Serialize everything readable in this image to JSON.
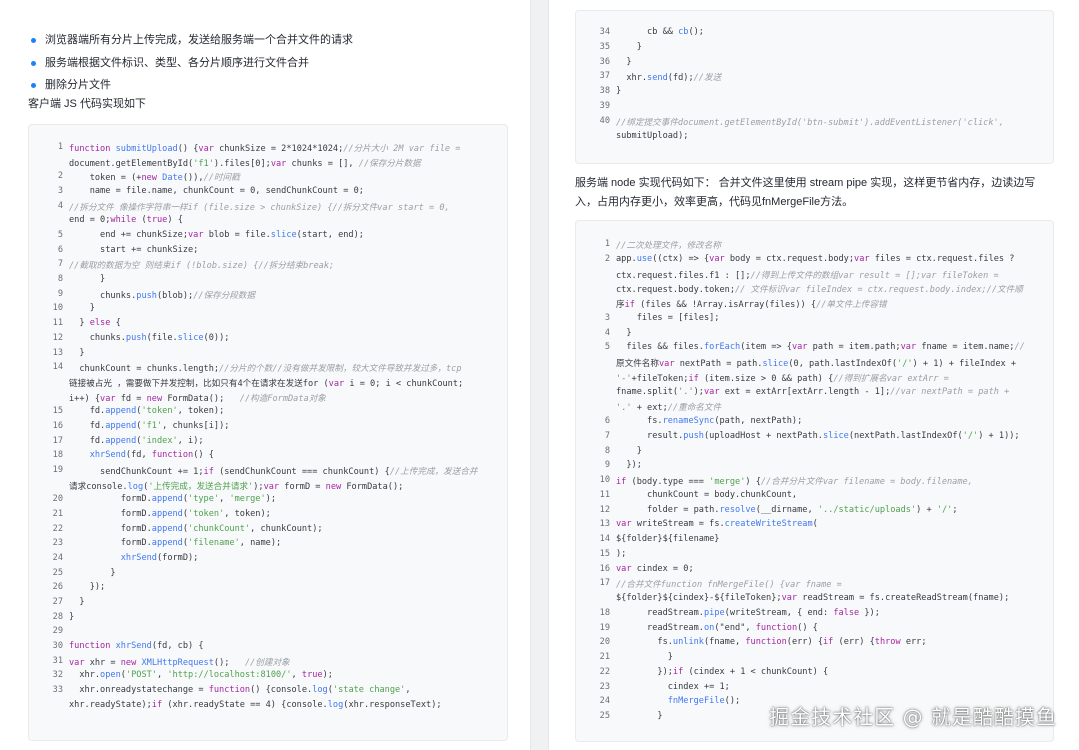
{
  "left": {
    "bullets": [
      "浏览器端所有分片上传完成，发送给服务端一个合并文件的请求",
      "服务端根据文件标识、类型、各分片顺序进行文件合并",
      "删除分片文件"
    ],
    "client_intro": "客户端 JS 代码实现如下",
    "code": [
      {
        "n": "1",
        "t": "function submitUpload() {var chunkSize = 2*1024*1024;//分片大小 2M var file = "
      },
      {
        "n": "",
        "t": "document.getElementById('f1').files[0];var chunks = [], //保存分片数据"
      },
      {
        "n": "2",
        "t": "    token = (+new Date()),//时间戳"
      },
      {
        "n": "3",
        "t": "    name = file.name, chunkCount = 0, sendChunkCount = 0;"
      },
      {
        "n": "4",
        "t": "//拆分文件 像操作字符串一样if (file.size > chunkSize) {//拆分文件var start = 0,"
      },
      {
        "n": "",
        "t": "end = 0;while (true) {"
      },
      {
        "n": "5",
        "t": "      end += chunkSize;var blob = file.slice(start, end);"
      },
      {
        "n": "6",
        "t": "      start += chunkSize;"
      },
      {
        "n": "7",
        "t": "//截取的数据为空 则结束if (!blob.size) {//拆分结束break;"
      },
      {
        "n": "8",
        "t": "      }"
      },
      {
        "n": "9",
        "t": "      chunks.push(blob);//保存分段数据"
      },
      {
        "n": "10",
        "t": "    }"
      },
      {
        "n": "11",
        "t": "  } else {"
      },
      {
        "n": "12",
        "t": "    chunks.push(file.slice(0));"
      },
      {
        "n": "13",
        "t": "  }"
      },
      {
        "n": "14",
        "t": "  chunkCount = chunks.length;//分片的个数//没有做并发限制，较大文件导致并发过多，tcp"
      },
      {
        "n": "",
        "t": "链接被占光 ，需要做下并发控制，比如只有4个在请求在发送for (var i = 0; i < chunkCount;"
      },
      {
        "n": "",
        "t": "i++) {var fd = new FormData();   //构造FormData对象"
      },
      {
        "n": "15",
        "t": "    fd.append('token', token);"
      },
      {
        "n": "16",
        "t": "    fd.append('f1', chunks[i]);"
      },
      {
        "n": "17",
        "t": "    fd.append('index', i);"
      },
      {
        "n": "18",
        "t": "    xhrSend(fd, function() {"
      },
      {
        "n": "19",
        "t": "      sendChunkCount += 1;if (sendChunkCount === chunkCount) {//上传完成，发送合并"
      },
      {
        "n": "",
        "t": "请求console.log('上传完成，发送合并请求');var formD = new FormData();"
      },
      {
        "n": "20",
        "t": "          formD.append('type', 'merge');"
      },
      {
        "n": "21",
        "t": "          formD.append('token', token);"
      },
      {
        "n": "22",
        "t": "          formD.append('chunkCount', chunkCount);"
      },
      {
        "n": "23",
        "t": "          formD.append('filename', name);"
      },
      {
        "n": "24",
        "t": "          xhrSend(formD);"
      },
      {
        "n": "25",
        "t": "        }"
      },
      {
        "n": "26",
        "t": "    });"
      },
      {
        "n": "27",
        "t": "  }"
      },
      {
        "n": "28",
        "t": "}"
      },
      {
        "n": "29",
        "t": ""
      },
      {
        "n": "30",
        "t": "function xhrSend(fd, cb) {"
      },
      {
        "n": "31",
        "t": "var xhr = new XMLHttpRequest();   //创建对象"
      },
      {
        "n": "32",
        "t": "  xhr.open('POST', 'http://localhost:8100/', true);"
      },
      {
        "n": "33",
        "t": "  xhr.onreadystatechange = function() {console.log('state change',"
      },
      {
        "n": "",
        "t": "xhr.readyState);if (xhr.readyState == 4) {console.log(xhr.responseText);"
      }
    ]
  },
  "right": {
    "code_top": [
      {
        "n": "34",
        "t": "      cb && cb();"
      },
      {
        "n": "35",
        "t": "    }"
      },
      {
        "n": "36",
        "t": "  }"
      },
      {
        "n": "37",
        "t": "  xhr.send(fd);//发送"
      },
      {
        "n": "38",
        "t": "}"
      },
      {
        "n": "39",
        "t": ""
      },
      {
        "n": "40",
        "t": "//绑定提交事件document.getElementById('btn-submit').addEventListener('click',"
      },
      {
        "n": "",
        "t": "submitUpload);"
      }
    ],
    "server_intro": "服务端 node 实现代码如下： 合并文件这里使用 stream pipe 实现，这样更节省内存，边读边写入，占用内存更小，效率更高，代码见fnMergeFile方法。",
    "code_bottom": [
      {
        "n": "1",
        "t": "//二次处理文件，修改名称"
      },
      {
        "n": "2",
        "t": "app.use((ctx) => {var body = ctx.request.body;var files = ctx.request.files ?"
      },
      {
        "n": "",
        "t": "ctx.request.files.f1 : [];//得到上传文件的数组var result = [];var fileToken ="
      },
      {
        "n": "",
        "t": "ctx.request.body.token;// 文件标识var fileIndex = ctx.request.body.index;//文件顺"
      },
      {
        "n": "",
        "t": "序if (files && !Array.isArray(files)) {//单文件上传容错"
      },
      {
        "n": "3",
        "t": "    files = [files];"
      },
      {
        "n": "4",
        "t": "  }"
      },
      {
        "n": "5",
        "t": "  files && files.forEach(item => {var path = item.path;var fname = item.name;//"
      },
      {
        "n": "",
        "t": "原文件名称var nextPath = path.slice(0, path.lastIndexOf('/') + 1) + fileIndex +"
      },
      {
        "n": "",
        "t": "'-'+fileToken;if (item.size > 0 && path) {//得到扩展名var extArr ="
      },
      {
        "n": "",
        "t": "fname.split('.');var ext = extArr[extArr.length - 1];//var nextPath = path +"
      },
      {
        "n": "",
        "t": "'.' + ext;//重命名文件"
      },
      {
        "n": "6",
        "t": "      fs.renameSync(path, nextPath);"
      },
      {
        "n": "7",
        "t": "      result.push(uploadHost + nextPath.slice(nextPath.lastIndexOf('/') + 1));"
      },
      {
        "n": "8",
        "t": "    }"
      },
      {
        "n": "9",
        "t": "  });"
      },
      {
        "n": "10",
        "t": "if (body.type === 'merge') {//合并分片文件var filename = body.filename,"
      },
      {
        "n": "11",
        "t": "      chunkCount = body.chunkCount,"
      },
      {
        "n": "12",
        "t": "      folder = path.resolve(__dirname, '../static/uploads') + '/';"
      },
      {
        "n": "13",
        "t": "var writeStream = fs.createWriteStream("
      },
      {
        "n": "14",
        "t": "${folder}${filename}"
      },
      {
        "n": "15",
        "t": ");"
      },
      {
        "n": "16",
        "t": "var cindex = 0;"
      },
      {
        "n": "17",
        "t": "//合并文件function fnMergeFile() {var fname ="
      },
      {
        "n": "",
        "t": "${folder}${cindex}-${fileToken};var readStream = fs.createReadStream(fname);"
      },
      {
        "n": "18",
        "t": "      readStream.pipe(writeStream, { end: false });"
      },
      {
        "n": "19",
        "t": "      readStream.on(\"end\", function() {"
      },
      {
        "n": "20",
        "t": "        fs.unlink(fname, function(err) {if (err) {throw err;"
      },
      {
        "n": "21",
        "t": "          }"
      },
      {
        "n": "22",
        "t": "        });if (cindex + 1 < chunkCount) {"
      },
      {
        "n": "23",
        "t": "          cindex += 1;"
      },
      {
        "n": "24",
        "t": "          fnMergeFile();"
      },
      {
        "n": "25",
        "t": "        }"
      }
    ]
  },
  "watermark": "掘金技术社区 @ 就是酷酷摸鱼"
}
